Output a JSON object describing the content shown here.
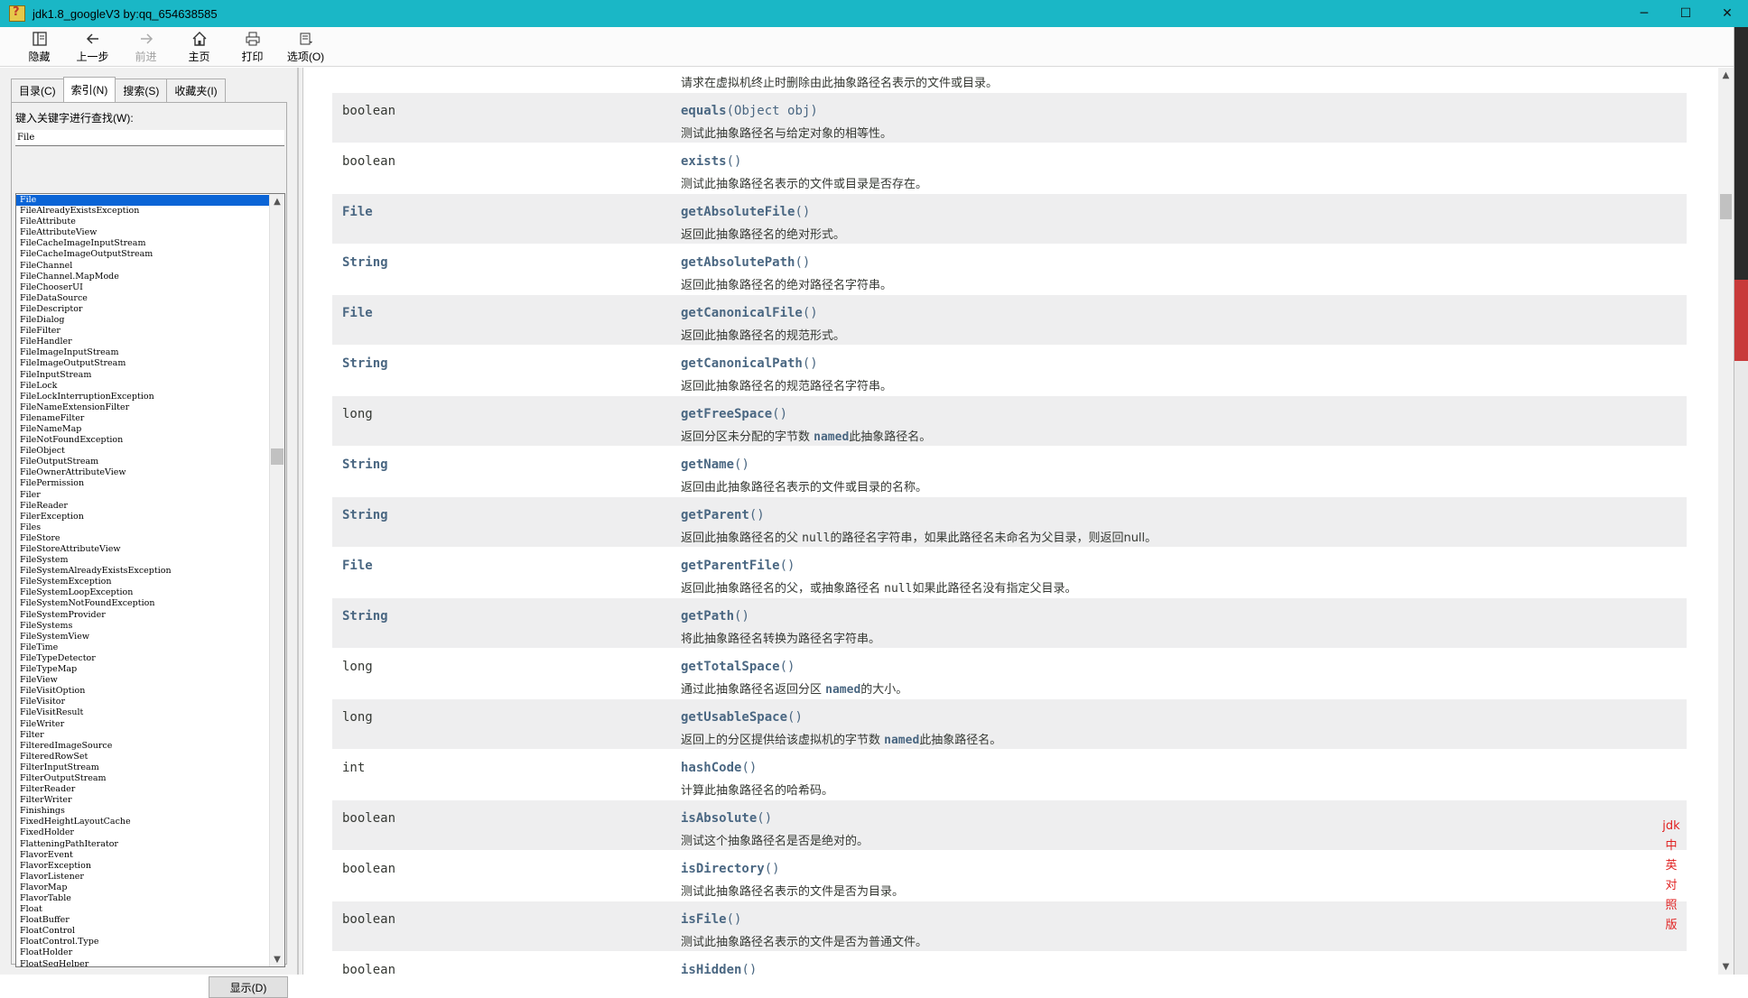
{
  "window": {
    "title": "jdk1.8_googleV3 by:qq_654638585",
    "min_label": "─",
    "max_label": "☐",
    "close_label": "✕"
  },
  "toolbar": {
    "hide_label": "隐藏",
    "back_label": "上一步",
    "forward_label": "前进",
    "home_label": "主页",
    "print_label": "打印",
    "options_label": "选项(O)"
  },
  "tabs": {
    "contents": "目录(C)",
    "index": "索引(N)",
    "search": "搜索(S)",
    "favorites": "收藏夹(I)"
  },
  "index_panel": {
    "keyword_label": "键入关键字进行查找(W):",
    "keyword_value": "File",
    "display_button": "显示(D)",
    "items": [
      "File",
      "FileAlreadyExistsException",
      "FileAttribute",
      "FileAttributeView",
      "FileCacheImageInputStream",
      "FileCacheImageOutputStream",
      "FileChannel",
      "FileChannel.MapMode",
      "FileChooserUI",
      "FileDataSource",
      "FileDescriptor",
      "FileDialog",
      "FileFilter",
      "FileHandler",
      "FileImageInputStream",
      "FileImageOutputStream",
      "FileInputStream",
      "FileLock",
      "FileLockInterruptionException",
      "FileNameExtensionFilter",
      "FilenameFilter",
      "FileNameMap",
      "FileNotFoundException",
      "FileObject",
      "FileOutputStream",
      "FileOwnerAttributeView",
      "FilePermission",
      "Filer",
      "FileReader",
      "FilerException",
      "Files",
      "FileStore",
      "FileStoreAttributeView",
      "FileSystem",
      "FileSystemAlreadyExistsException",
      "FileSystemException",
      "FileSystemLoopException",
      "FileSystemNotFoundException",
      "FileSystemProvider",
      "FileSystems",
      "FileSystemView",
      "FileTime",
      "FileTypeDetector",
      "FileTypeMap",
      "FileView",
      "FileVisitOption",
      "FileVisitor",
      "FileVisitResult",
      "FileWriter",
      "Filter",
      "FilteredImageSource",
      "FilteredRowSet",
      "FilterInputStream",
      "FilterOutputStream",
      "FilterReader",
      "FilterWriter",
      "Finishings",
      "FixedHeightLayoutCache",
      "FixedHolder",
      "FlatteningPathIterator",
      "FlavorEvent",
      "FlavorException",
      "FlavorListener",
      "FlavorMap",
      "FlavorTable",
      "Float",
      "FloatBuffer",
      "FloatControl",
      "FloatControl.Type",
      "FloatHolder",
      "FloatSeqHelper"
    ]
  },
  "content": {
    "top_partial_text": "请求在虚拟机终止时删除由此抽象路径名表示的文件或目录。",
    "side_note": [
      "jdk",
      "中",
      "英",
      "对",
      "照",
      "版"
    ],
    "rows": [
      {
        "type": "boolean",
        "type_link": false,
        "name": "equals",
        "params": "Object obj",
        "desc_parts": [
          {
            "t": "测试此抽象路径名与给定对象的相等性。"
          }
        ]
      },
      {
        "type": "boolean",
        "type_link": false,
        "name": "exists",
        "params": "",
        "desc_parts": [
          {
            "t": "测试此抽象路径名表示的文件或目录是否存在。"
          }
        ]
      },
      {
        "type": "File",
        "type_link": true,
        "name": "getAbsoluteFile",
        "params": "",
        "desc_parts": [
          {
            "t": "返回此抽象路径名的绝对形式。"
          }
        ]
      },
      {
        "type": "String",
        "type_link": true,
        "name": "getAbsolutePath",
        "params": "",
        "desc_parts": [
          {
            "t": "返回此抽象路径名的绝对路径名字符串。"
          }
        ]
      },
      {
        "type": "File",
        "type_link": true,
        "name": "getCanonicalFile",
        "params": "",
        "desc_parts": [
          {
            "t": "返回此抽象路径名的规范形式。"
          }
        ]
      },
      {
        "type": "String",
        "type_link": true,
        "name": "getCanonicalPath",
        "params": "",
        "desc_parts": [
          {
            "t": "返回此抽象路径名的规范路径名字符串。"
          }
        ]
      },
      {
        "type": "long",
        "type_link": false,
        "name": "getFreeSpace",
        "params": "",
        "desc_parts": [
          {
            "t": "返回分区未分配的字节数 "
          },
          {
            "t": "named",
            "kw": true
          },
          {
            "t": "此抽象路径名。"
          }
        ]
      },
      {
        "type": "String",
        "type_link": true,
        "name": "getName",
        "params": "",
        "desc_parts": [
          {
            "t": "返回由此抽象路径名表示的文件或目录的名称。"
          }
        ]
      },
      {
        "type": "String",
        "type_link": true,
        "name": "getParent",
        "params": "",
        "desc_parts": [
          {
            "t": "返回此抽象路径名的父 "
          },
          {
            "t": "null",
            "mono": true
          },
          {
            "t": "的路径名字符串，如果此路径名未命名为父目录，则返回null。"
          }
        ]
      },
      {
        "type": "File",
        "type_link": true,
        "name": "getParentFile",
        "params": "",
        "desc_parts": [
          {
            "t": "返回此抽象路径名的父，或抽象路径名 "
          },
          {
            "t": "null",
            "mono": true
          },
          {
            "t": "如果此路径名没有指定父目录。"
          }
        ]
      },
      {
        "type": "String",
        "type_link": true,
        "name": "getPath",
        "params": "",
        "desc_parts": [
          {
            "t": "将此抽象路径名转换为路径名字符串。"
          }
        ]
      },
      {
        "type": "long",
        "type_link": false,
        "name": "getTotalSpace",
        "params": "",
        "desc_parts": [
          {
            "t": "通过此抽象路径名返回分区 "
          },
          {
            "t": "named",
            "kw": true
          },
          {
            "t": "的大小。"
          }
        ]
      },
      {
        "type": "long",
        "type_link": false,
        "name": "getUsableSpace",
        "params": "",
        "desc_parts": [
          {
            "t": "返回上的分区提供给该虚拟机的字节数 "
          },
          {
            "t": "named",
            "kw": true
          },
          {
            "t": "此抽象路径名。"
          }
        ]
      },
      {
        "type": "int",
        "type_link": false,
        "name": "hashCode",
        "params": "",
        "desc_parts": [
          {
            "t": "计算此抽象路径名的哈希码。"
          }
        ]
      },
      {
        "type": "boolean",
        "type_link": false,
        "name": "isAbsolute",
        "params": "",
        "desc_parts": [
          {
            "t": "测试这个抽象路径名是否是绝对的。"
          }
        ]
      },
      {
        "type": "boolean",
        "type_link": false,
        "name": "isDirectory",
        "params": "",
        "desc_parts": [
          {
            "t": "测试此抽象路径名表示的文件是否为目录。"
          }
        ]
      },
      {
        "type": "boolean",
        "type_link": false,
        "name": "isFile",
        "params": "",
        "desc_parts": [
          {
            "t": "测试此抽象路径名表示的文件是否为普通文件。"
          }
        ]
      },
      {
        "type": "boolean",
        "type_link": false,
        "name": "isHidden",
        "params": "",
        "desc_parts": [
          {
            "t": ""
          }
        ]
      }
    ]
  },
  "colors": {
    "titlebar": "#1ab7c6",
    "link": "#4a6782",
    "row_alt": "#eeeeef",
    "selection": "#0a64d6",
    "note_red": "#e02020"
  }
}
